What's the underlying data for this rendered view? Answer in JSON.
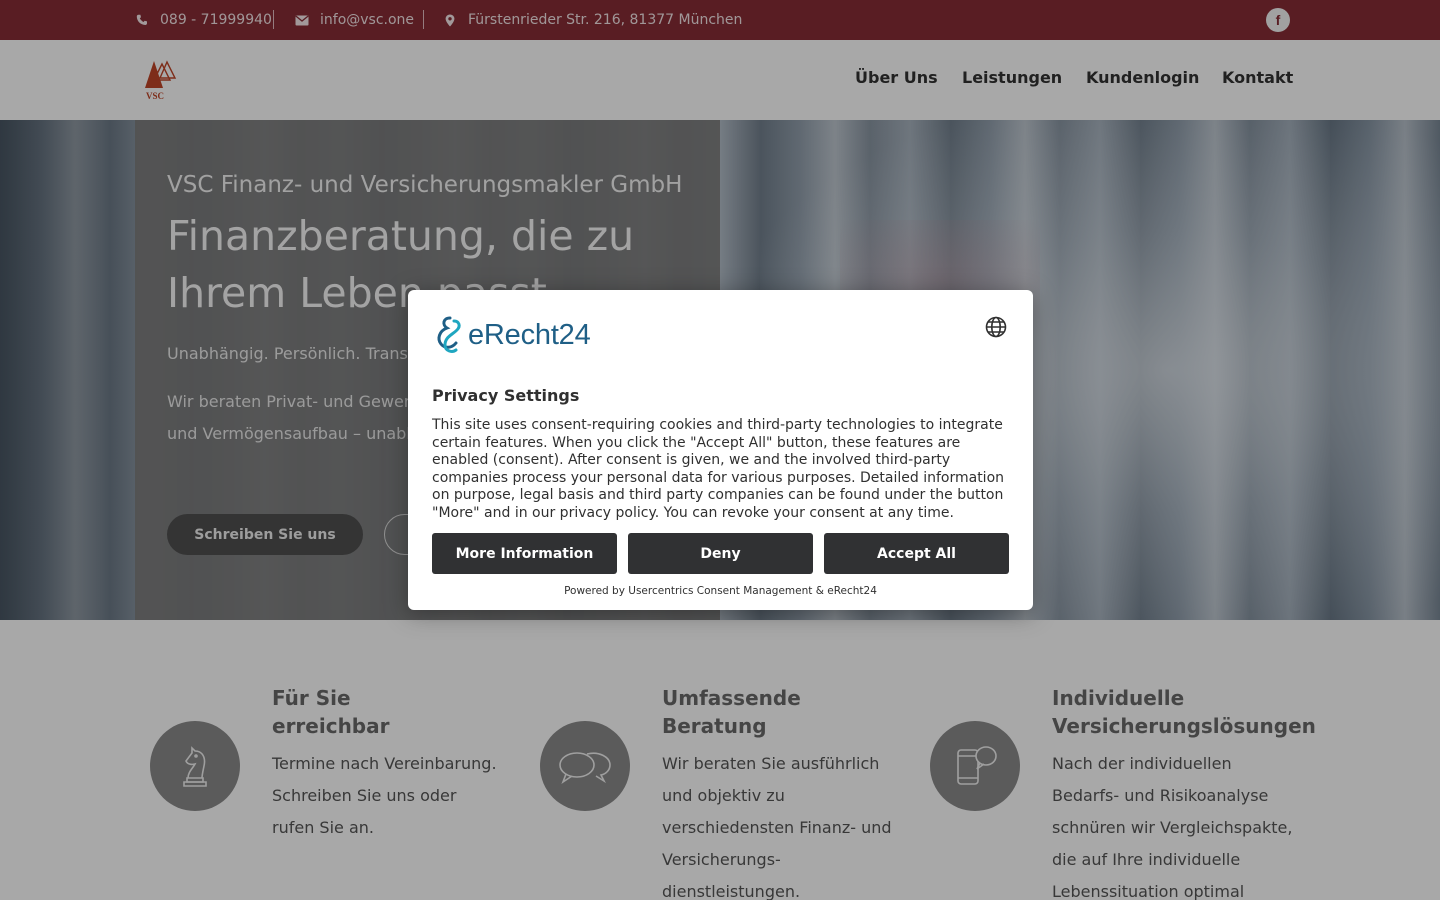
{
  "topbar": {
    "phone": "089 - 71999940",
    "email": "info@vsc.one",
    "address": "Fürstenrieder Str. 216, 81377 München",
    "facebook_label": "f"
  },
  "header": {
    "logo_text": "VSC",
    "nav": [
      "Über Uns",
      "Leistungen",
      "Kundenlogin",
      "Kontakt"
    ]
  },
  "hero": {
    "company": "VSC Finanz- und Versicherungsmakler GmbH",
    "title": "Finanzberatung, die zu Ihrem Leben passt",
    "tagline": "Unabhängig. Persönlich. Transparent.",
    "text": "Wir beraten Privat- und Gewerbekunden zu Versicherung, Vorsorge und Vermögensaufbau – unabhängig, persönlich und langfristig.",
    "primary_button": "Schreiben Sie uns"
  },
  "features": [
    {
      "icon": "chess-knight-icon",
      "title": "Für Sie erreichbar",
      "text": "Termine nach Vereinbarung. Schreiben Sie uns oder rufen Sie an."
    },
    {
      "icon": "chat-bubbles-icon",
      "title": "Umfassende Beratung",
      "text": "Wir beraten Sie ausführlich und objektiv zu verschiedensten Finanz- und Versicherungs-dienstleistungen."
    },
    {
      "icon": "smartphone-chat-icon",
      "title": "Individuelle Versicherungslösungen",
      "text": "Nach der individuellen Bedarfs- und Risikoanalyse schnüren wir Vergleichspakte, die auf Ihre individuelle Lebenssituation optimal zugeschnitten sind."
    }
  ],
  "consent": {
    "brand": "eRecht24",
    "title": "Privacy Settings",
    "body": "This site uses consent-requiring cookies and third-party technologies to integrate certain features. When you click the \"Accept All\" button, these features are enabled (consent). After consent is given, we and the involved third-party companies process your personal data for various purposes. Detailed information on purpose, legal basis and third party companies can be found under the button \"More\" and in our privacy policy. You can revoke your consent at any time.",
    "more_button": "More Information",
    "deny_button": "Deny",
    "accept_button": "Accept All",
    "footer": "Powered by Usercentrics Consent Management & eRecht24"
  },
  "colors": {
    "topbar": "#872d36",
    "modal_button": "#303133",
    "brand_blue": "#1f5f86"
  }
}
